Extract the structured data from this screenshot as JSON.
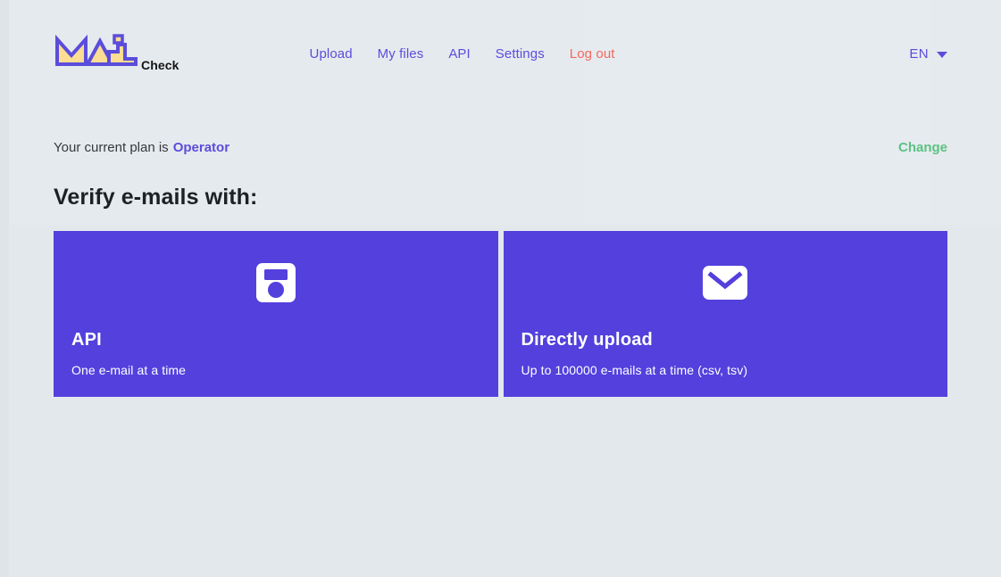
{
  "brand": {
    "wordmark": "MAIL",
    "suffix": "Check",
    "mark_icon": "mail-logo-icon",
    "colors": {
      "outline": "#5b4ddb",
      "fill": "#fbdd93"
    }
  },
  "nav": {
    "items": [
      {
        "label": "Upload",
        "name": "nav-upload"
      },
      {
        "label": "My files",
        "name": "nav-my-files"
      },
      {
        "label": "API",
        "name": "nav-api"
      },
      {
        "label": "Settings",
        "name": "nav-settings"
      },
      {
        "label": "Log out",
        "name": "nav-logout"
      }
    ]
  },
  "language": {
    "selected": "EN",
    "caret_icon": "chevron-down-icon"
  },
  "plan": {
    "prefix": "Your current plan is",
    "name": "Operator",
    "change_label": "Change"
  },
  "main": {
    "title": "Verify e-mails with:",
    "cards": [
      {
        "title": "API",
        "subtitle": "One e-mail at a time",
        "icon": "save-floppy-icon"
      },
      {
        "title": "Directly upload",
        "subtitle": "Up to 100000 e-mails at a time (csv, tsv)",
        "icon": "envelope-icon"
      }
    ]
  },
  "colors": {
    "background": "#e3e8ec",
    "primary": "#5340dd",
    "accent_link": "#5b4ddb",
    "logout": "#f5685d",
    "success": "#5cc282",
    "heading": "#1d2125"
  }
}
